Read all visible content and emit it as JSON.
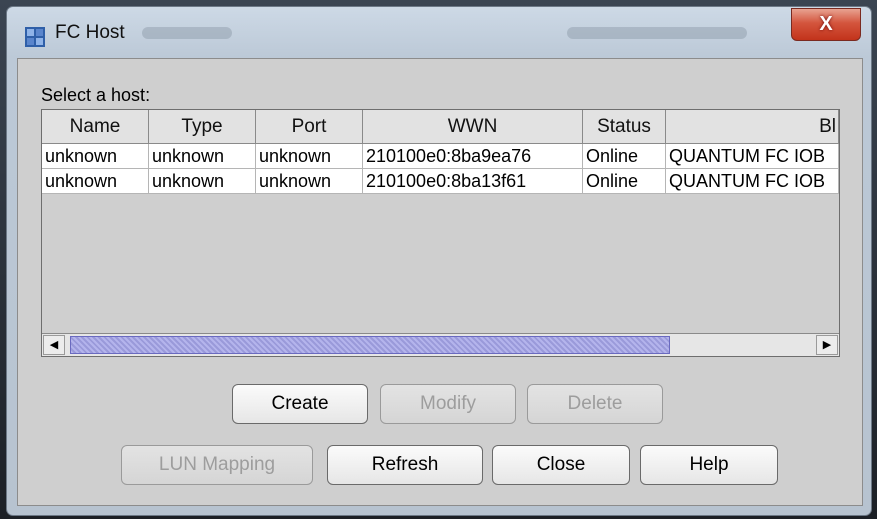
{
  "window": {
    "title": "FC Host",
    "close_glyph": "X",
    "icon": "app-window-icon"
  },
  "section_label": "Select a host:",
  "table": {
    "columns": [
      "Name",
      "Type",
      "Port",
      "WWN",
      "Status",
      "Bl"
    ],
    "rows": [
      [
        "unknown",
        "unknown",
        "unknown",
        "210100e0:8ba9ea76",
        "Online",
        "QUANTUM  FC IOB"
      ],
      [
        "unknown",
        "unknown",
        "unknown",
        "210100e0:8ba13f61",
        "Online",
        "QUANTUM  FC IOB"
      ]
    ],
    "scroll_left_glyph": "◀",
    "scroll_right_glyph": "▶"
  },
  "buttons": {
    "create": "Create",
    "modify": "Modify",
    "delete": "Delete",
    "lun_mapping": "LUN Mapping",
    "refresh": "Refresh",
    "close": "Close",
    "help": "Help"
  }
}
